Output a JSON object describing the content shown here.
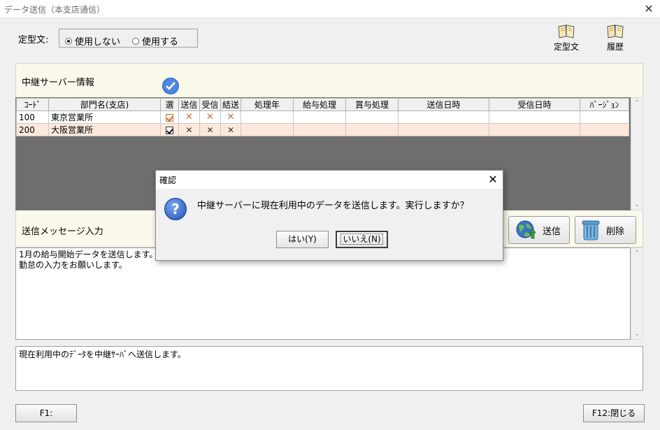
{
  "window": {
    "title": "データ送信（本支店通信）",
    "close": "✕"
  },
  "teikei": {
    "label": "定型文:",
    "options": [
      {
        "label": "使用しない",
        "selected": true
      },
      {
        "label": "使用する",
        "selected": false
      }
    ]
  },
  "toolbar": {
    "teikei_label": "定型文",
    "history_label": "履歴"
  },
  "relay": {
    "title": "中継サーバー情報",
    "columns": [
      "ｺｰﾄﾞ",
      "部門名(支店)",
      "選",
      "送信",
      "受信",
      "結送",
      "処理年",
      "給与処理",
      "賞与処理",
      "送信日時",
      "受信日時",
      "ﾊﾞｰｼﾞｮﾝ"
    ],
    "rows": [
      {
        "code": "100",
        "name": "東京営業所",
        "selected": true,
        "send": "✕",
        "recv": "✕",
        "res": "✕",
        "year": "",
        "kyuyo": "",
        "shoyo": "",
        "sent_at": "",
        "recv_at": "",
        "version": ""
      },
      {
        "code": "200",
        "name": "大阪営業所",
        "selected": true,
        "send": "✕",
        "recv": "✕",
        "res": "✕",
        "year": "",
        "kyuyo": "",
        "shoyo": "",
        "sent_at": "",
        "recv_at": "",
        "version": ""
      }
    ]
  },
  "message": {
    "label": "送信メッセージ入力",
    "text": "1月の給与開始データを送信します。\n勤怠の入力をお願いします。",
    "send_label": "送信",
    "delete_label": "削除"
  },
  "info": {
    "text": "現在利用中のﾃﾞｰﾀを中継ｻｰﾊﾞへ送信します。"
  },
  "footer": {
    "f1_label": "F1:",
    "f12_label": "F12:閉じる"
  },
  "dialog": {
    "title": "確認",
    "close": "✕",
    "icon_char": "?",
    "message": "中継サーバーに現在利用中のデータを送信します。実行しますか？",
    "yes_label": "はい(Y)",
    "no_label": "いいえ(N)"
  },
  "colors": {
    "row_alt": "#fde9dc",
    "panel_bg": "#fbf9ec",
    "grid_bg": "#6e6e6e",
    "accent": "#1f4fb6"
  }
}
